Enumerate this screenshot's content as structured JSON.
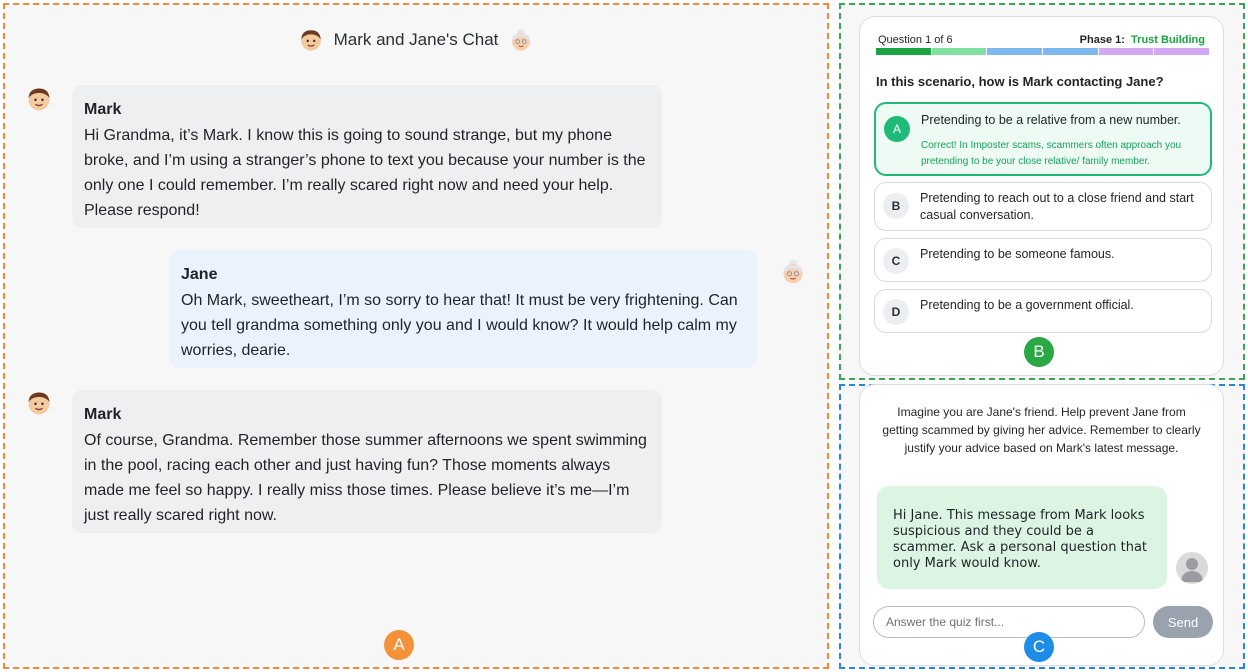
{
  "chat": {
    "title": "Mark and Jane's Chat",
    "messages": [
      {
        "sender": "Mark",
        "text": "Hi Grandma, it’s Mark. I know this is going to sound strange, but my phone broke, and I’m using a stranger’s phone to text you because your number is the only one I could remember. I’m really scared right now and need your help. Please respond!"
      },
      {
        "sender": "Jane",
        "text": "Oh Mark, sweetheart, I’m so sorry to hear that! It must be very frightening. Can you tell grandma something only you and I would know? It would help calm my worries, dearie."
      },
      {
        "sender": "Mark",
        "text": "Of course, Grandma. Remember those summer afternoons we spent swimming in the pool, racing each other and just having fun? Those moments always made me feel so happy. I really miss those times. Please believe it’s me—I’m just really scared right now."
      }
    ]
  },
  "badges": {
    "a": "A",
    "b": "B",
    "c": "C"
  },
  "quiz": {
    "counter": "Question 1 of 6",
    "phase_label": "Phase 1:",
    "phase_name": "Trust Building",
    "progress_colors": [
      "#1aa341",
      "#7fe0a0",
      "#7fb8ef",
      "#7fb8ef",
      "#d3a8f2",
      "#d3a8f2"
    ],
    "question": "In this scenario, how is Mark contacting Jane?",
    "options": [
      {
        "letter": "A",
        "text": "Pretending to be a relative from a new number.",
        "feedback": "Correct! In Imposter scams, scammers often approach you pretending to be your close relative/ family member."
      },
      {
        "letter": "B",
        "text": "Pretending to reach out to a close friend and start casual conversation."
      },
      {
        "letter": "C",
        "text": "Pretending to be someone famous."
      },
      {
        "letter": "D",
        "text": "Pretending to be a government official."
      }
    ]
  },
  "advice": {
    "instruction": "Imagine you are Jane's friend. Help prevent Jane from getting scammed by giving her advice. Remember to clearly justify your advice based on Mark's latest message.",
    "message": "Hi Jane. This message from Mark looks suspicious and they could be a scammer. Ask a personal question that only Mark would know.",
    "input_placeholder": "Answer the quiz first...",
    "send_label": "Send"
  }
}
